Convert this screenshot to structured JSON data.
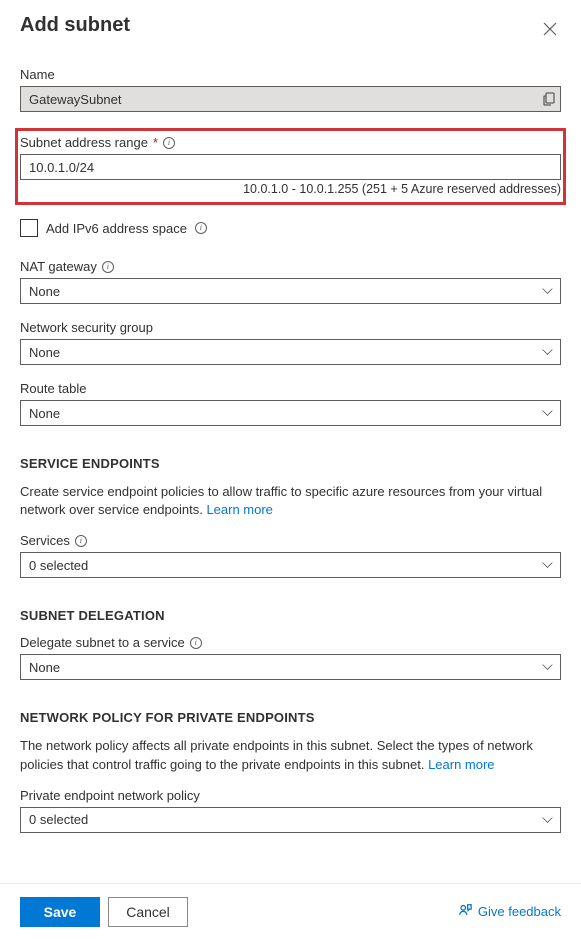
{
  "header": {
    "title": "Add subnet"
  },
  "nameField": {
    "label": "Name",
    "value": "GatewaySubnet"
  },
  "addressRange": {
    "label": "Subnet address range",
    "value": "10.0.1.0/24",
    "helper": "10.0.1.0 - 10.0.1.255 (251 + 5 Azure reserved addresses)"
  },
  "ipv6": {
    "label": "Add IPv6 address space"
  },
  "natGateway": {
    "label": "NAT gateway",
    "value": "None"
  },
  "nsg": {
    "label": "Network security group",
    "value": "None"
  },
  "routeTable": {
    "label": "Route table",
    "value": "None"
  },
  "serviceEndpoints": {
    "heading": "SERVICE ENDPOINTS",
    "desc": "Create service endpoint policies to allow traffic to specific azure resources from your virtual network over service endpoints. ",
    "learnMore": "Learn more",
    "servicesLabel": "Services",
    "servicesValue": "0 selected"
  },
  "delegation": {
    "heading": "SUBNET DELEGATION",
    "label": "Delegate subnet to a service",
    "value": "None"
  },
  "privateEndpoints": {
    "heading": "NETWORK POLICY FOR PRIVATE ENDPOINTS",
    "desc": "The network policy affects all private endpoints in this subnet. Select the types of network policies that control traffic going to the private endpoints in this subnet. ",
    "learnMore": "Learn more",
    "policyLabel": "Private endpoint network policy",
    "policyValue": "0 selected"
  },
  "footer": {
    "save": "Save",
    "cancel": "Cancel",
    "feedback": "Give feedback"
  }
}
